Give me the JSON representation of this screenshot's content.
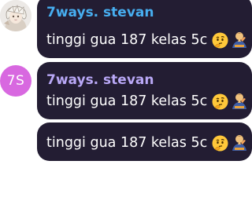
{
  "messages": [
    {
      "sender": "7ways. stevan",
      "text": "tinggi gua 187 kelas 5c",
      "sender_color": "#47aef0",
      "avatar": "photo-avatar",
      "emojis": [
        "thinking-face-icon",
        "person-prayer-icon"
      ]
    },
    {
      "sender": "7ways. stevan",
      "text": "tinggi gua 187 kelas 5c",
      "sender_color": "#b9a8f6",
      "avatar_initials": "7S",
      "avatar_color": "#d868e0",
      "emojis": [
        "thinking-face-icon",
        "person-prayer-icon"
      ]
    },
    {
      "text": "tinggi gua 187 kelas 5c",
      "emojis": [
        "thinking-face-icon",
        "person-prayer-icon"
      ]
    }
  ],
  "colors": {
    "bubble_bg": "#231d33",
    "text": "#ffffff",
    "page_bg": "#ffffff"
  }
}
